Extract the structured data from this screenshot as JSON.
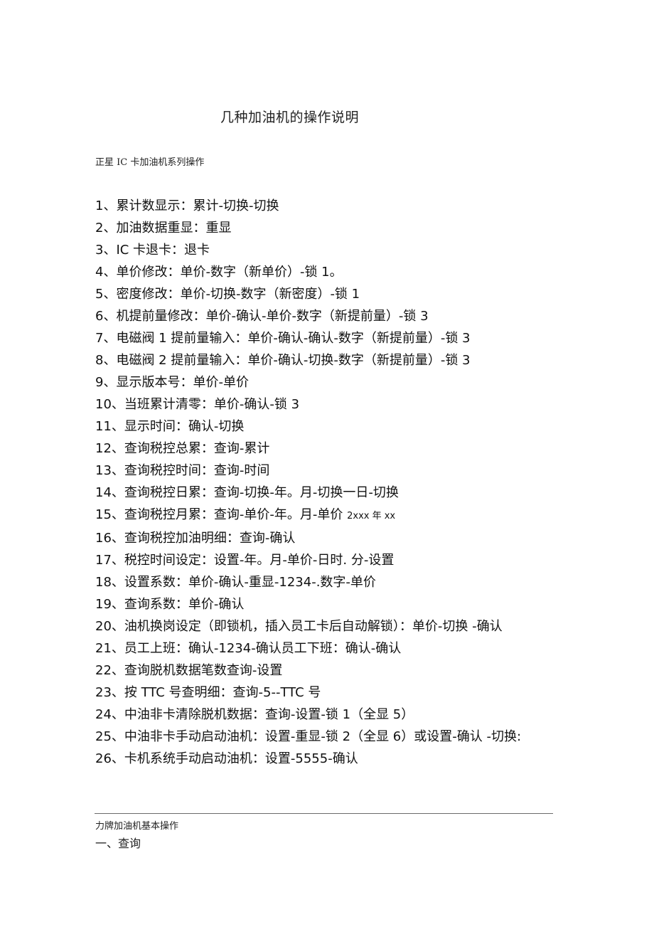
{
  "document": {
    "title": "几种加油机的操作说明",
    "section1": {
      "heading": "正星 IC 卡加油机系列操作",
      "steps": [
        {
          "num": "1",
          "text": "累计数显示：累计-切换-切换"
        },
        {
          "num": "2",
          "text": "加油数据重显：重显"
        },
        {
          "num": "3",
          "text": "IC 卡退卡：退卡"
        },
        {
          "num": "4",
          "text": "单价修改：单价-数字（新单价）-锁 1。"
        },
        {
          "num": "5",
          "text": "密度修改：单价-切换-数字（新密度）-锁 1"
        },
        {
          "num": "6",
          "text": "机提前量修改：单价-确认-单价-数字（新提前量）-锁 3"
        },
        {
          "num": "7",
          "text": "电磁阀 1 提前量输入：单价-确认-确认-数字（新提前量）-锁 3"
        },
        {
          "num": "8",
          "text": "电磁阀 2 提前量输入：单价-确认-切换-数字（新提前量）-锁 3"
        },
        {
          "num": "9",
          "text": "显示版本号：单价-单价"
        },
        {
          "num": "10",
          "text": "当班累计清零：单价-确认-锁 3"
        },
        {
          "num": "11",
          "text": "显示时间：确认-切换"
        },
        {
          "num": "12",
          "text": "查询税控总累：查询-累计"
        },
        {
          "num": "13",
          "text": "查询税控时间：查询-时间"
        },
        {
          "num": "14",
          "text": "查询税控日累：查询-切换-年。月-切换一日-切换"
        },
        {
          "num": "15",
          "text": "查询税控月累：查询-单价-年。月-单价",
          "note": "2xxx 年 xx"
        },
        {
          "num": "16",
          "text": "查询税控加油明细：查询-确认"
        },
        {
          "num": "17",
          "text": "税控时间设定：设置-年。月-单价-日时. 分-设置"
        },
        {
          "num": "18",
          "text": "设置系数：单价-确认-重显-1234-.数字-单价"
        },
        {
          "num": "19",
          "text": "查询系数：单价-确认"
        },
        {
          "num": "20",
          "text": "油机换岗设定（即锁机，插入员工卡后自动解锁）：单价-切换 -确认"
        },
        {
          "num": "21",
          "text": "员工上班：确认-1234-确认员工下班：确认-确认"
        },
        {
          "num": "22",
          "text": "查询脱机数据笔数查询-设置"
        },
        {
          "num": "23",
          "text": "按 TTC 号查明细：查询-5--TTC 号"
        },
        {
          "num": "24",
          "text": "中油非卡清除脱机数据：查询-设置-锁 1（全显 5）"
        },
        {
          "num": "25",
          "text": "中油非卡手动启动油机：设置-重显-锁 2（全显 6）或设置-确认 -切换:"
        },
        {
          "num": "26",
          "text": "卡机系统手动启动油机：设置-5555-确认"
        }
      ]
    },
    "section2": {
      "heading": "力牌加油机基本操作",
      "subsection": "一、查询"
    },
    "separator": "、"
  }
}
